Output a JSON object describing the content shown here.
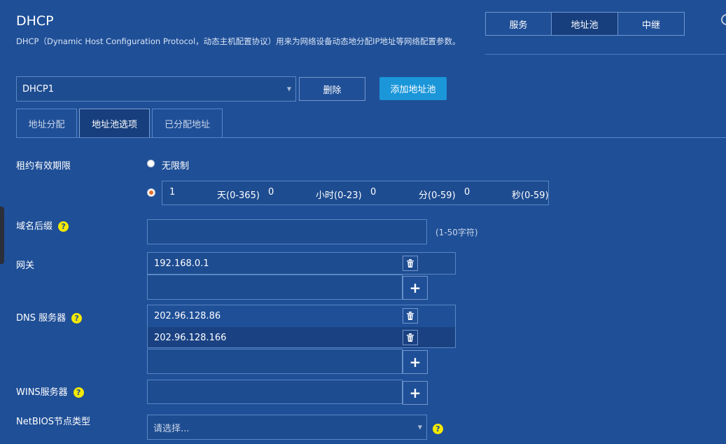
{
  "header": {
    "title": "DHCP",
    "description": "DHCP（Dynamic Host Configuration Protocol，动态主机配置协议）用来为网络设备动态地分配IP地址等网络配置参数。"
  },
  "top_tabs": [
    {
      "label": "服务",
      "active": false
    },
    {
      "label": "地址池",
      "active": true
    },
    {
      "label": "中继",
      "active": false
    }
  ],
  "pool": {
    "selected": "DHCP1",
    "delete_label": "删除",
    "add_label": "添加地址池"
  },
  "sub_tabs": [
    {
      "label": "地址分配",
      "active": false
    },
    {
      "label": "地址池选项",
      "active": true
    },
    {
      "label": "已分配地址",
      "active": false
    }
  ],
  "lease": {
    "label": "租约有效期限",
    "unlimited_label": "无限制",
    "selected_option": "custom",
    "days_value": "1",
    "days_unit": "天(0-365)",
    "hours_value": "0",
    "hours_unit": "小时(0-23)",
    "minutes_value": "0",
    "minutes_unit": "分(0-59)",
    "seconds_value": "0",
    "seconds_unit": "秒(0-59)"
  },
  "domain_suffix": {
    "label": "域名后缀",
    "value": "",
    "hint": "(1-50字符)"
  },
  "gateway": {
    "label": "网关",
    "entries": [
      "192.168.0.1"
    ]
  },
  "dns": {
    "label": "DNS 服务器",
    "entries": [
      "202.96.128.86",
      "202.96.128.166"
    ]
  },
  "wins": {
    "label": "WINS服务器"
  },
  "netbios": {
    "label": "NetBIOS节点类型",
    "placeholder": "请选择..."
  },
  "icons": {
    "help": "help-icon",
    "delete": "trash-icon",
    "add": "plus-icon",
    "dropdown": "caret-down-icon"
  },
  "colors": {
    "background": "#1f4f97",
    "primary_button": "#1a96d9",
    "help_badge": "#f3e900",
    "active_tab": "#173f7e"
  }
}
